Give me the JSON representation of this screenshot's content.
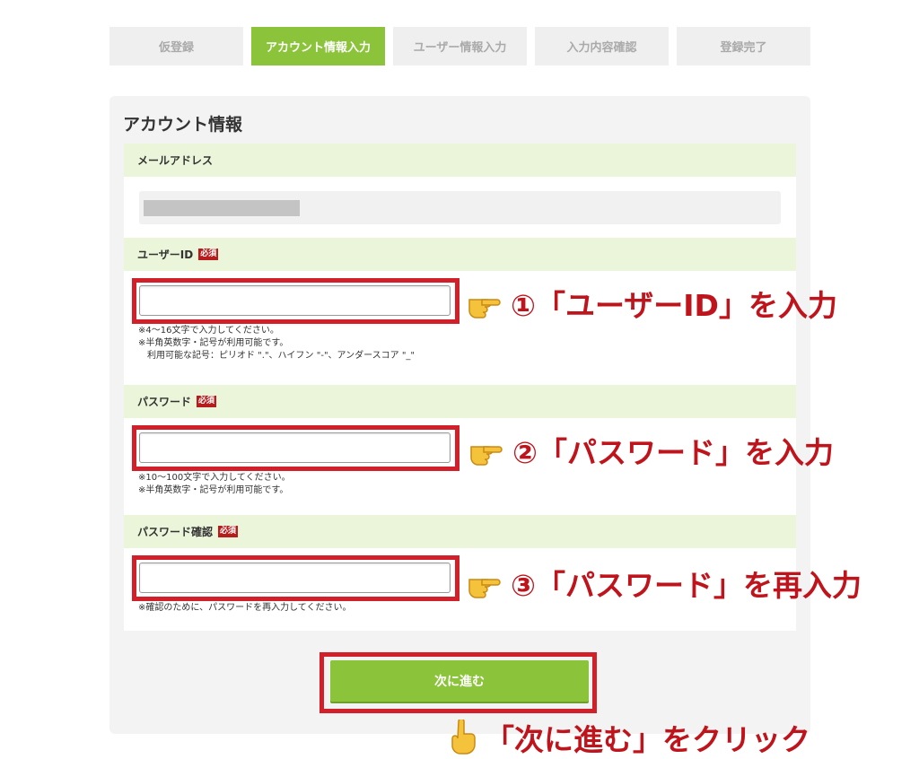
{
  "steps": [
    {
      "label": "仮登録",
      "active": false
    },
    {
      "label": "アカウント情報入力",
      "active": true
    },
    {
      "label": "ユーザー情報入力",
      "active": false
    },
    {
      "label": "入力内容確認",
      "active": false
    },
    {
      "label": "登録完了",
      "active": false
    }
  ],
  "section_title": "アカウント情報",
  "email": {
    "label": "メールアドレス"
  },
  "required_badge": "必須",
  "user_id": {
    "label": "ユーザーID",
    "value": "",
    "notes": "※4〜16文字で入力してください。\n※半角英数字・記号が利用可能です。\n　利用可能な記号：ピリオド \".\"、ハイフン \"-\"、アンダースコア \"_\""
  },
  "password": {
    "label": "パスワード",
    "value": "",
    "notes": "※10〜100文字で入力してください。\n※半角英数字・記号が利用可能です。"
  },
  "password_confirm": {
    "label": "パスワード確認",
    "value": "",
    "notes": "※確認のために、パスワードを再入力してください。"
  },
  "callouts": {
    "c1": "①「ユーザーID」を入力",
    "c2": "②「パスワード」を入力",
    "c3": "③「パスワード」を再入力",
    "c4": "「次に進む」をクリック"
  },
  "next_button": "次に進む",
  "colors": {
    "accent": "#8bc33a",
    "highlight": "#d1202a",
    "callout_text": "#c0141c"
  }
}
